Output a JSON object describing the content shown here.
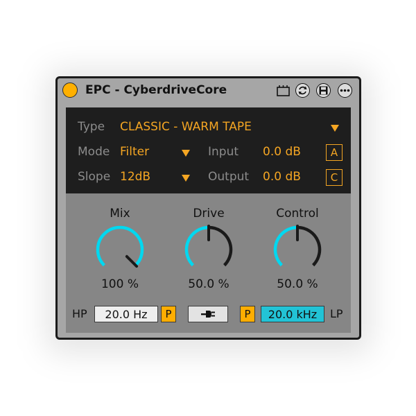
{
  "window": {
    "title": "EPC - CyberdriveCore",
    "accent_color": "#ffb000",
    "icons": [
      "device-icon",
      "sync-icon",
      "save-icon",
      "more-icon"
    ]
  },
  "settings": {
    "type_label": "Type",
    "type_value": "CLASSIC - WARM TAPE",
    "mode_label": "Mode",
    "mode_value": "Filter",
    "slope_label": "Slope",
    "slope_value": "12dB",
    "input_label": "Input",
    "input_value": "0.0 dB",
    "output_label": "Output",
    "output_value": "0.0 dB",
    "a_button": "A",
    "c_button": "C",
    "value_color": "#f5a623"
  },
  "knobs": [
    {
      "label": "Mix",
      "value_text": "100 %",
      "level": 1.0
    },
    {
      "label": "Drive",
      "value_text": "50.0 %",
      "level": 0.5
    },
    {
      "label": "Control",
      "value_text": "50.0 %",
      "level": 0.5
    }
  ],
  "knob_color": "#00d8f0",
  "filter": {
    "hp_label": "HP",
    "hp_value": "20.0 Hz",
    "hp_p_button": "P",
    "link_icon": "plug-icon",
    "lp_p_button": "P",
    "lp_value": "20.0 kHz",
    "lp_label": "LP",
    "lp_active_color": "#22c3d6"
  }
}
